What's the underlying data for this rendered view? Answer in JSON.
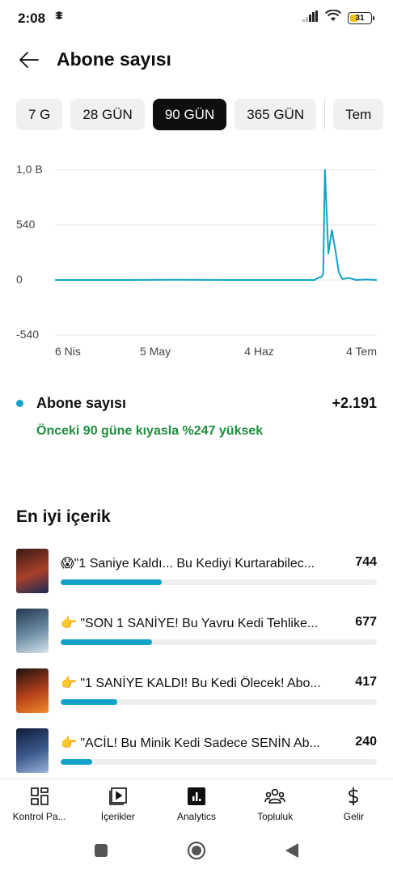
{
  "status_bar": {
    "time": "2:08",
    "battery": "31"
  },
  "header": {
    "title": "Abone sayısı"
  },
  "chips": [
    {
      "label": "7 G",
      "active": false
    },
    {
      "label": "28 GÜN",
      "active": false
    },
    {
      "label": "90 GÜN",
      "active": true
    },
    {
      "label": "365 GÜN",
      "active": false
    },
    {
      "label": "Tem",
      "active": false
    }
  ],
  "chart_data": {
    "type": "line",
    "y_ticks": [
      "1,0 B",
      "540",
      "0",
      "-540"
    ],
    "y_tick_values": [
      1080,
      540,
      0,
      -540
    ],
    "x_ticks": [
      "6 Nis",
      "5 May",
      "4 Haz",
      "4 Tem"
    ],
    "x_tick_days": [
      0,
      29,
      59,
      89
    ],
    "ylim": [
      -540,
      1080
    ],
    "xlim": [
      0,
      93
    ],
    "grid": true,
    "series": [
      {
        "color": "#12a2c9",
        "points": [
          [
            0,
            0
          ],
          [
            10,
            0
          ],
          [
            20,
            0
          ],
          [
            35,
            2
          ],
          [
            50,
            0
          ],
          [
            60,
            0
          ],
          [
            70,
            0
          ],
          [
            75,
            0
          ],
          [
            76,
            20
          ],
          [
            77,
            30
          ],
          [
            77.5,
            60
          ],
          [
            78,
            1080
          ],
          [
            79,
            260
          ],
          [
            80,
            490
          ],
          [
            81,
            300
          ],
          [
            82,
            80
          ],
          [
            83,
            10
          ],
          [
            85,
            20
          ],
          [
            87,
            0
          ],
          [
            90,
            5
          ],
          [
            93,
            0
          ]
        ]
      }
    ]
  },
  "metric": {
    "name": "Abone sayısı",
    "value": "+2.191",
    "comparison": "Önceki 90 güne kıyasla %247 yüksek"
  },
  "top_content": {
    "title": "En iyi içerik",
    "items": [
      {
        "title": "😱\"1 Saniye Kaldı... Bu Kediyi Kurtarabilec...",
        "value": "744",
        "fraction": 0.32,
        "thumb_colors": [
          "#3a1a14",
          "#a8402a",
          "#1a2a55"
        ]
      },
      {
        "title": "👉 \"SON 1 SANİYE! Bu Yavru Kedi Tehlike...",
        "value": "677",
        "fraction": 0.29,
        "thumb_colors": [
          "#22384f",
          "#6e8ea6",
          "#d8e4ec"
        ]
      },
      {
        "title": "👉 \"1 SANİYE KALDI! Bu Kedi Ölecek! Abo...",
        "value": "417",
        "fraction": 0.18,
        "thumb_colors": [
          "#1c1210",
          "#b4401a",
          "#f08a2a"
        ]
      },
      {
        "title": "👉 \"ACİL! Bu Minik Kedi Sadece SENİN Ab...",
        "value": "240",
        "fraction": 0.1,
        "thumb_colors": [
          "#0f1c3a",
          "#3c5a8c",
          "#9ab4d8"
        ]
      }
    ]
  },
  "bottom_nav": [
    {
      "label": "Kontrol Pa...",
      "icon": "dashboard-icon"
    },
    {
      "label": "İçerikler",
      "icon": "content-icon"
    },
    {
      "label": "Analytics",
      "icon": "analytics-icon"
    },
    {
      "label": "Topluluk",
      "icon": "community-icon"
    },
    {
      "label": "Gelir",
      "icon": "earn-icon"
    }
  ]
}
